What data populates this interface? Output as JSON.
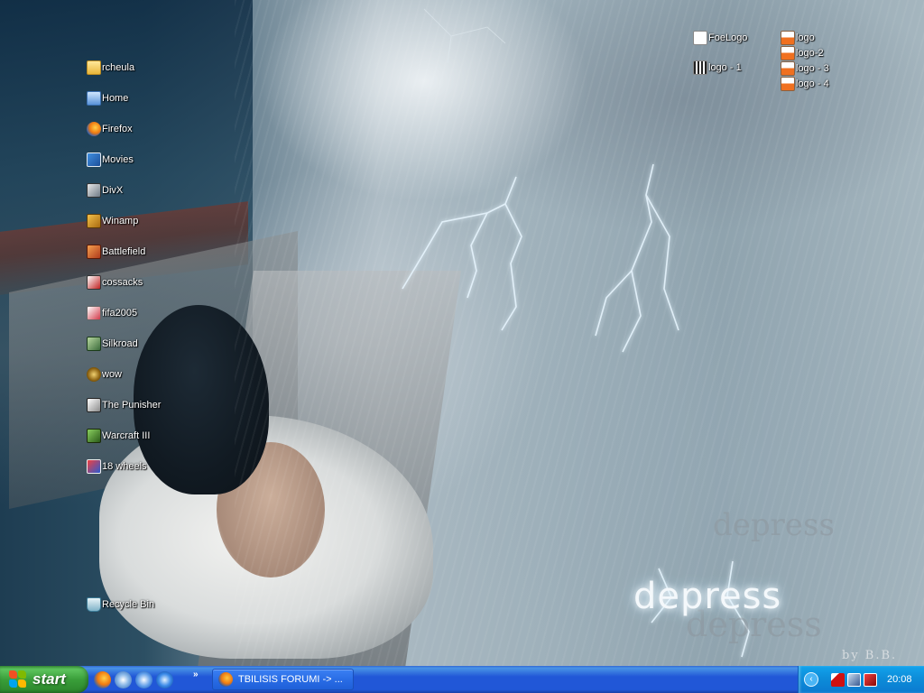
{
  "wallpaper": {
    "caption": "depress",
    "credit": "by B.B."
  },
  "desktop": {
    "left_icons": [
      {
        "label": "rcheula",
        "icon": "folder-icon"
      },
      {
        "label": "Home",
        "icon": "home-icon"
      },
      {
        "label": "Firefox",
        "icon": "firefox-icon"
      },
      {
        "label": "Movies",
        "icon": "movies-icon"
      },
      {
        "label": "DivX",
        "icon": "divx-icon"
      },
      {
        "label": "Winamp",
        "icon": "winamp-icon"
      },
      {
        "label": "Battlefield",
        "icon": "battlefield-icon"
      },
      {
        "label": "cossacks",
        "icon": "cossacks-icon"
      },
      {
        "label": "fifa2005",
        "icon": "fifa-icon"
      },
      {
        "label": "Silkroad",
        "icon": "silkroad-icon"
      },
      {
        "label": "wow",
        "icon": "wow-icon"
      },
      {
        "label": "The Punisher",
        "icon": "punisher-icon"
      },
      {
        "label": "Warcraft III",
        "icon": "warcraft-icon"
      },
      {
        "label": "18 wheels",
        "icon": "truck-icon"
      }
    ],
    "recycle_bin": {
      "label": "Recycle Bin",
      "icon": "recycle-bin-icon"
    },
    "right_icons": [
      {
        "label": "FoeLogo",
        "icon": "image-file-icon"
      },
      {
        "label": "logo - 1",
        "icon": "image-file-icon"
      },
      {
        "label": "logo",
        "icon": "document-icon"
      },
      {
        "label": "logo-2",
        "icon": "document-icon"
      },
      {
        "label": "logo - 3",
        "icon": "document-icon"
      },
      {
        "label": "logo - 4",
        "icon": "document-icon"
      }
    ]
  },
  "taskbar": {
    "start_label": "start",
    "quick_launch": [
      "firefox-icon",
      "messenger-icon",
      "media-player-icon",
      "internet-explorer-icon"
    ],
    "overflow": "»",
    "task_button": "TBILISIS FORUMI -> ...",
    "tray_icons": [
      "kaspersky-icon",
      "network-icon",
      "antivirus-icon"
    ],
    "clock": "20:08",
    "colors": {
      "bar": "#2157d7",
      "start": "#3a9e3a",
      "tray": "#0d8dd9"
    }
  }
}
